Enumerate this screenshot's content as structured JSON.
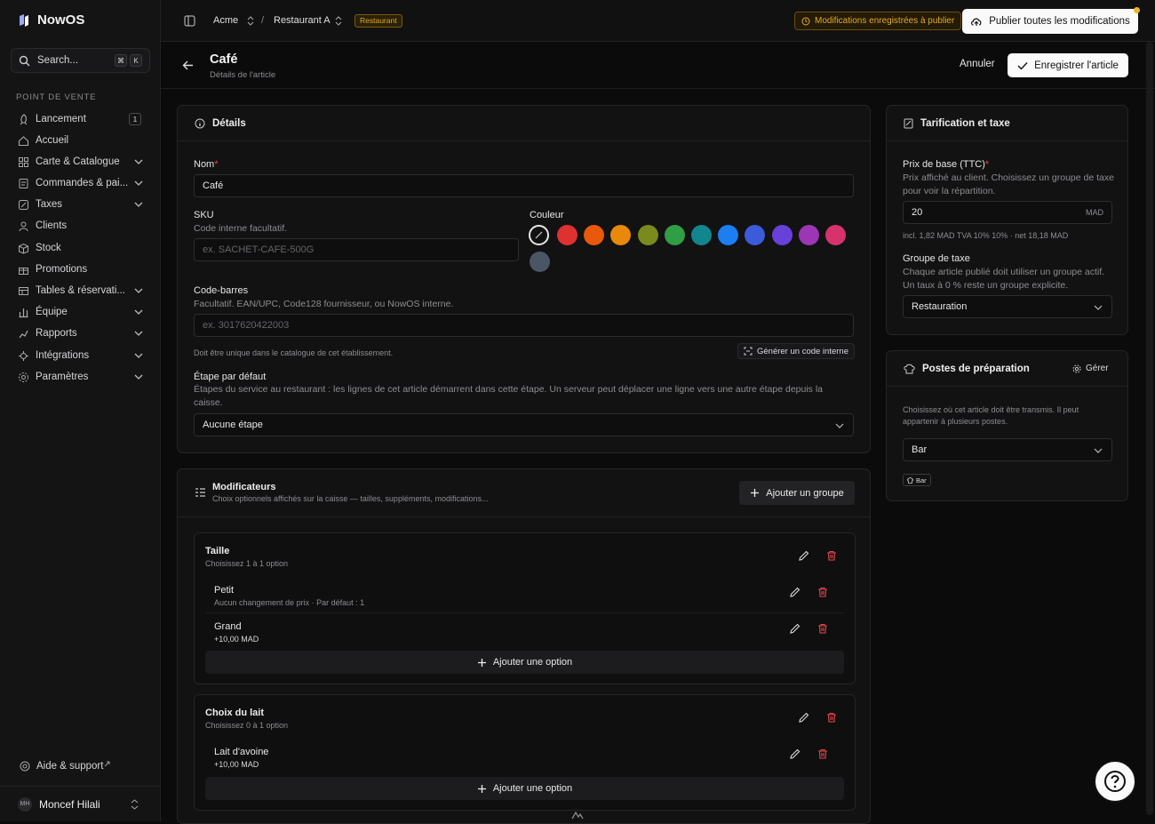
{
  "app": {
    "name": "NowOS"
  },
  "search": {
    "placeholder": "Search...",
    "key1": "⌘",
    "key2": "K"
  },
  "sidebar": {
    "section": "POINT DE VENTE",
    "items": [
      {
        "label": "Lancement",
        "icon": "rocket-icon",
        "badge": "1"
      },
      {
        "label": "Accueil",
        "icon": "home-icon"
      },
      {
        "label": "Carte & Catalogue",
        "icon": "grid-icon"
      },
      {
        "label": "Commandes & pai...",
        "icon": "receipt-icon"
      },
      {
        "label": "Taxes",
        "icon": "percent-icon"
      },
      {
        "label": "Clients",
        "icon": "users-icon"
      },
      {
        "label": "Stock",
        "icon": "box-icon"
      },
      {
        "label": "Promotions",
        "icon": "gift-icon"
      },
      {
        "label": "Tables & réservati...",
        "icon": "table-icon"
      },
      {
        "label": "Équipe",
        "icon": "team-icon"
      },
      {
        "label": "Rapports",
        "icon": "chart-icon"
      },
      {
        "label": "Intégrations",
        "icon": "plug-icon"
      },
      {
        "label": "Paramètres",
        "icon": "gear-icon"
      }
    ],
    "help": "Aide & support",
    "user": {
      "initials": "MH",
      "name": "Moncef Hilali"
    }
  },
  "topbar": {
    "org": "Acme",
    "sep": "/",
    "site": "Restaurant A",
    "tag": "Restaurant",
    "pending": "Modifications enregistrées à publier",
    "publish": "Publier toutes les modifications"
  },
  "header": {
    "title": "Café",
    "subtitle": "Détails de l'article",
    "cancel": "Annuler",
    "save": "Enregistrer l'article"
  },
  "details": {
    "title": "Détails",
    "name_label": "Nom",
    "name_value": "Café",
    "sku_label": "SKU",
    "sku_hint": "Code interne facultatif.",
    "sku_placeholder": "ex. SACHET-CAFE-500G",
    "color_label": "Couleur",
    "colors": [
      "#e03131",
      "#e8590c",
      "#e8890c",
      "#7a8a1c",
      "#2f9e44",
      "#12868f",
      "#1c7ef0",
      "#3b5bdb",
      "#6741d9",
      "#9c36b5",
      "#d6336c",
      "#4a5565"
    ],
    "barcode_label": "Code-barres",
    "barcode_hint": "Facultatif. EAN/UPC, Code128 fournisseur, ou NowOS interne.",
    "barcode_placeholder": "ex. 3017620422003",
    "barcode_note": "Doit être unique dans le catalogue de cet établissement.",
    "generate": "Générer un code interne",
    "stage_label": "Étape par défaut",
    "stage_hint": "Étapes du service au restaurant : les lignes de cet article démarrent dans cette étape. Un serveur peut déplacer une ligne vers une autre étape depuis la caisse.",
    "stage_value": "Aucune étape"
  },
  "modifiers": {
    "title": "Modificateurs",
    "subtitle": "Choix optionnels affichés sur la caisse — tailles, suppléments, modifications...",
    "add_group": "Ajouter un groupe",
    "add_option": "Ajouter une option",
    "groups": [
      {
        "name": "Taille",
        "rule": "Choisissez 1 à 1 option",
        "options": [
          {
            "name": "Petit",
            "detail": "Aucun changement de prix · Par défaut : 1"
          },
          {
            "name": "Grand",
            "detail": "+10,00 MAD"
          }
        ]
      },
      {
        "name": "Choix du lait",
        "rule": "Choisissez 0 à 1 option",
        "options": [
          {
            "name": "Lait d'avoine",
            "detail": "+10,00 MAD"
          }
        ]
      }
    ]
  },
  "pricing": {
    "title": "Tarification et taxe",
    "price_label": "Prix de base (TTC)",
    "price_hint": "Prix affiché au client. Choisissez un groupe de taxe pour voir la répartition.",
    "price_value": "20",
    "currency": "MAD",
    "breakdown": "incl. 1,82 MAD TVA 10% 10% · net 18,18 MAD",
    "tax_label": "Groupe de taxe",
    "tax_hint": "Chaque article publié doit utiliser un groupe actif. Un taux à 0 % reste un groupe explicite.",
    "tax_value": "Restauration"
  },
  "stations": {
    "title": "Postes de préparation",
    "manage": "Gérer",
    "hint": "Choisissez où cet article doit être transmis. Il peut appartenir à plusieurs postes.",
    "value": "Bar",
    "chip": "Bar"
  }
}
